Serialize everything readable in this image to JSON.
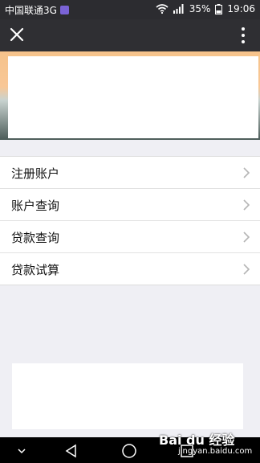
{
  "status_bar": {
    "carrier": "中国联通3G",
    "battery": "35%",
    "time": "19:06"
  },
  "menu": {
    "items": [
      {
        "label": "注册账户"
      },
      {
        "label": "账户查询"
      },
      {
        "label": "贷款查询"
      },
      {
        "label": "贷款试算"
      }
    ]
  },
  "watermark": {
    "text": "Bai du 经验",
    "url": "jingyan.baidu.com"
  }
}
